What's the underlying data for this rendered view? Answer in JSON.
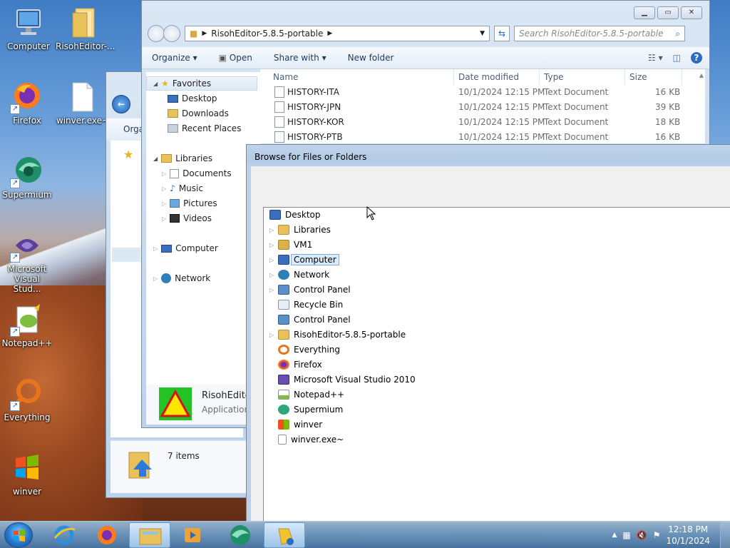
{
  "desktop": {
    "icons": [
      {
        "label": "Computer",
        "icon": "computer-icon"
      },
      {
        "label": "RisohEditor-...",
        "icon": "folder-icon"
      },
      {
        "label": "Firefox",
        "icon": "firefox-icon"
      },
      {
        "label": "winver.exe~",
        "icon": "file-icon"
      },
      {
        "label": "Supermium",
        "icon": "supermium-icon"
      },
      {
        "label": "Microsoft Visual Stud...",
        "icon": "visual-studio-icon"
      },
      {
        "label": "Notepad++",
        "icon": "notepadpp-icon"
      },
      {
        "label": "Everything",
        "icon": "everything-icon"
      },
      {
        "label": "winver",
        "icon": "windows-flag-icon"
      }
    ]
  },
  "back_explorer": {
    "toolbar_label": "Orga",
    "status": "7 items"
  },
  "explorer": {
    "address": "RisohEditor-5.8.5-portable",
    "search_placeholder": "Search RisohEditor-5.8.5-portable",
    "toolbar": {
      "organize": "Organize",
      "open": "Open",
      "share_with": "Share with",
      "new_folder": "New folder"
    },
    "nav": {
      "favorites": "Favorites",
      "desktop": "Desktop",
      "downloads": "Downloads",
      "recent_places": "Recent Places",
      "libraries": "Libraries",
      "documents": "Documents",
      "music": "Music",
      "pictures": "Pictures",
      "videos": "Videos",
      "computer": "Computer",
      "network": "Network"
    },
    "columns": {
      "name": "Name",
      "date": "Date modified",
      "type": "Type",
      "size": "Size"
    },
    "files": [
      {
        "name": "HISTORY-ITA",
        "date": "10/1/2024 12:15 PM",
        "type": "Text Document",
        "size": "16 KB"
      },
      {
        "name": "HISTORY-JPN",
        "date": "10/1/2024 12:15 PM",
        "type": "Text Document",
        "size": "39 KB"
      },
      {
        "name": "HISTORY-KOR",
        "date": "10/1/2024 12:15 PM",
        "type": "Text Document",
        "size": "18 KB"
      },
      {
        "name": "HISTORY-PTB",
        "date": "10/1/2024 12:15 PM",
        "type": "Text Document",
        "size": "16 KB"
      }
    ],
    "details": {
      "name": "RisohEdito",
      "type": "Application"
    }
  },
  "browse_dialog": {
    "title": "Browse for Files or Folders",
    "tree": [
      {
        "label": "Desktop",
        "expander": false,
        "icon": "desktop-icon",
        "color": "#3a6fc0"
      },
      {
        "label": "Libraries",
        "expander": true,
        "icon": "libraries-icon",
        "color": "#e9c15a"
      },
      {
        "label": "VM1",
        "expander": true,
        "icon": "user-folder-icon",
        "color": "#d9b24a"
      },
      {
        "label": "Computer",
        "expander": true,
        "icon": "computer-icon",
        "color": "#3a6fc0",
        "selected": true
      },
      {
        "label": "Network",
        "expander": true,
        "icon": "network-icon",
        "color": "#2d7fb8"
      },
      {
        "label": "Control Panel",
        "expander": true,
        "icon": "control-panel-icon",
        "color": "#5a8fc8"
      },
      {
        "label": "Recycle Bin",
        "expander": false,
        "icon": "recycle-bin-icon",
        "color": "#c9d6e3"
      },
      {
        "label": "Control Panel",
        "expander": false,
        "icon": "control-panel-icon",
        "color": "#5a8fc8"
      },
      {
        "label": "RisohEditor-5.8.5-portable",
        "expander": true,
        "icon": "folder-icon",
        "color": "#e9c15a"
      },
      {
        "label": "Everything",
        "expander": false,
        "icon": "everything-icon",
        "color": "#e8741c"
      },
      {
        "label": "Firefox",
        "expander": false,
        "icon": "firefox-icon",
        "color": "#ff7a1a"
      },
      {
        "label": "Microsoft Visual Studio 2010",
        "expander": false,
        "icon": "visual-studio-icon",
        "color": "#6b4fb0"
      },
      {
        "label": "Notepad++",
        "expander": false,
        "icon": "notepadpp-icon",
        "color": "#7fbf3f"
      },
      {
        "label": "Supermium",
        "expander": false,
        "icon": "supermium-icon",
        "color": "#2aa87a"
      },
      {
        "label": "winver",
        "expander": false,
        "icon": "windows-flag-icon",
        "color": "#3c9be0"
      },
      {
        "label": "winver.exe~",
        "expander": false,
        "icon": "file-icon",
        "color": "#ffffff"
      }
    ]
  },
  "taskbar": {
    "apps": [
      {
        "icon": "internet-explorer-icon",
        "active": false
      },
      {
        "icon": "firefox-icon",
        "active": false
      },
      {
        "icon": "explorer-icon",
        "active": true
      },
      {
        "icon": "media-player-icon",
        "active": false
      },
      {
        "icon": "supermium-icon",
        "active": false
      },
      {
        "icon": "risoheditor-icon",
        "active": true
      }
    ],
    "time": "12:18 PM",
    "date": "10/1/2024"
  },
  "colors": {
    "selection": "#d9eaf9",
    "selection_border": "#84acdd",
    "link_text": "#1e395b"
  }
}
